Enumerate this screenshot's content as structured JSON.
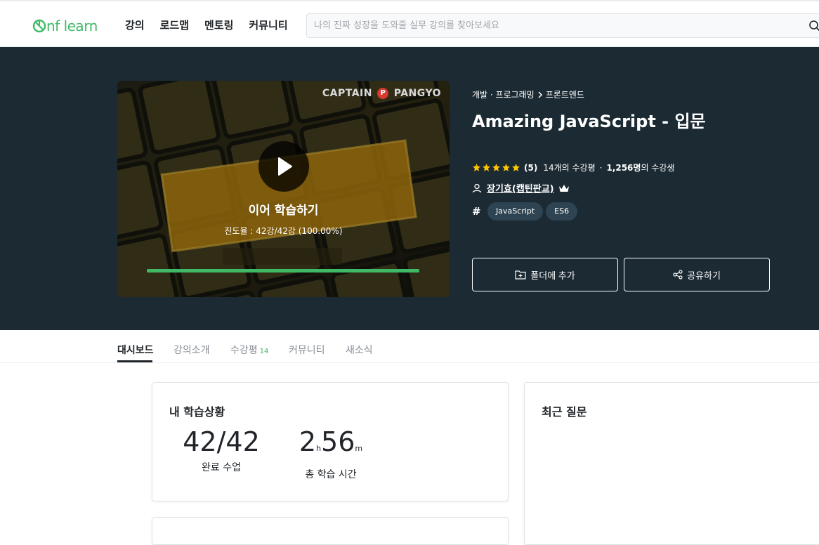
{
  "header": {
    "logo_text": "inflearn",
    "nav": [
      "강의",
      "로드맵",
      "멘토링",
      "커뮤니티"
    ],
    "search_placeholder": "나의 진짜 성장을 도와줄 실무 강의를 찾아보세요"
  },
  "hero": {
    "thumbnail": {
      "brand": "CAPTAIN",
      "brand_mark": "P",
      "brand_suffix": "PANGYO",
      "continue_label": "이어 학습하기",
      "progress_text": "진도율 : 42강/42강 (100.00%)",
      "progress_fraction": 1.0
    },
    "breadcrumb": [
      "개발 · 프로그래밍",
      "프론트엔드"
    ],
    "title": "Amazing JavaScript - 입문",
    "rating": {
      "stars": 5,
      "score_text": "(5)",
      "review_count_text": "14개의 수강평",
      "students_strong": "1,256명",
      "students_suffix": "의 수강생"
    },
    "instructor": "장기효(캡틴판교)",
    "tags": [
      "JavaScript",
      "ES6"
    ],
    "buttons": {
      "folder": "폴더에 추가",
      "share": "공유하기"
    }
  },
  "tabs": {
    "items": [
      "대시보드",
      "강의소개",
      "수강평",
      "커뮤니티",
      "새소식"
    ],
    "review_count": "14",
    "active": "대시보드"
  },
  "dashboard": {
    "progress_card": {
      "title": "내 학습상황",
      "completed_value": "42/42",
      "completed_label": "완료 수업",
      "time_hours": "2",
      "time_hours_unit": "h",
      "time_minutes": "56",
      "time_minutes_unit": "m",
      "time_label": "총 학습 시간"
    },
    "questions_card": {
      "title": "최근 질문"
    }
  },
  "colors": {
    "brand_green": "#3fb966",
    "hero_bg": "#1b2a33",
    "tag_bg": "#2e4452",
    "star": "#ffc600"
  }
}
